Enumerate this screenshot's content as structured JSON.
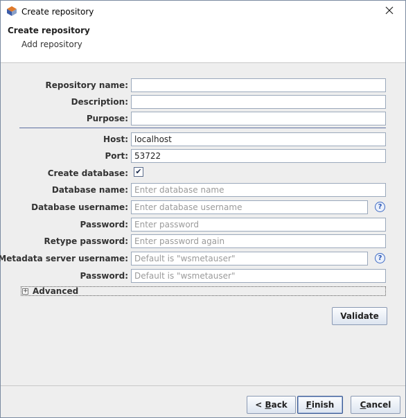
{
  "window": {
    "title": "Create repository"
  },
  "header": {
    "title": "Create repository",
    "subtitle": "Add repository"
  },
  "form": {
    "repository_name": {
      "label": "Repository name:",
      "value": ""
    },
    "description": {
      "label": "Description:",
      "value": ""
    },
    "purpose": {
      "label": "Purpose:",
      "value": ""
    },
    "host": {
      "label": "Host:",
      "value": "localhost"
    },
    "port": {
      "label": "Port:",
      "value": "53722"
    },
    "create_database": {
      "label": "Create database:",
      "checked": true,
      "mark": "✔"
    },
    "database_name": {
      "label": "Database name:",
      "placeholder": "Enter database name"
    },
    "database_username": {
      "label": "Database username:",
      "placeholder": "Enter database username"
    },
    "password": {
      "label": "Password:",
      "placeholder": "Enter password"
    },
    "retype_password": {
      "label": "Retype password:",
      "placeholder": "Enter password again"
    },
    "metadata_username": {
      "label": "Metadata server username:",
      "placeholder": "Default is \"wsmetauser\""
    },
    "metadata_password": {
      "label": "Password:",
      "placeholder": "Default is \"wsmetauser\""
    },
    "help_glyph": "?",
    "advanced": {
      "label": "Advanced",
      "toggle": "+"
    }
  },
  "buttons": {
    "validate": "Validate",
    "back_prefix": "< ",
    "back_mnemonic": "B",
    "back_rest": "ack",
    "finish_mnemonic": "F",
    "finish_rest": "inish",
    "cancel_mnemonic": "C",
    "cancel_rest": "ancel"
  },
  "icons": {
    "app": "app-logo-icon",
    "close": "close-icon",
    "help": "help-icon",
    "expand": "expand-icon"
  },
  "colors": {
    "accent": "#3f6bc5",
    "separator": "#5c6fa0",
    "field_border": "#9aa8bb",
    "background": "#eeeeee"
  }
}
